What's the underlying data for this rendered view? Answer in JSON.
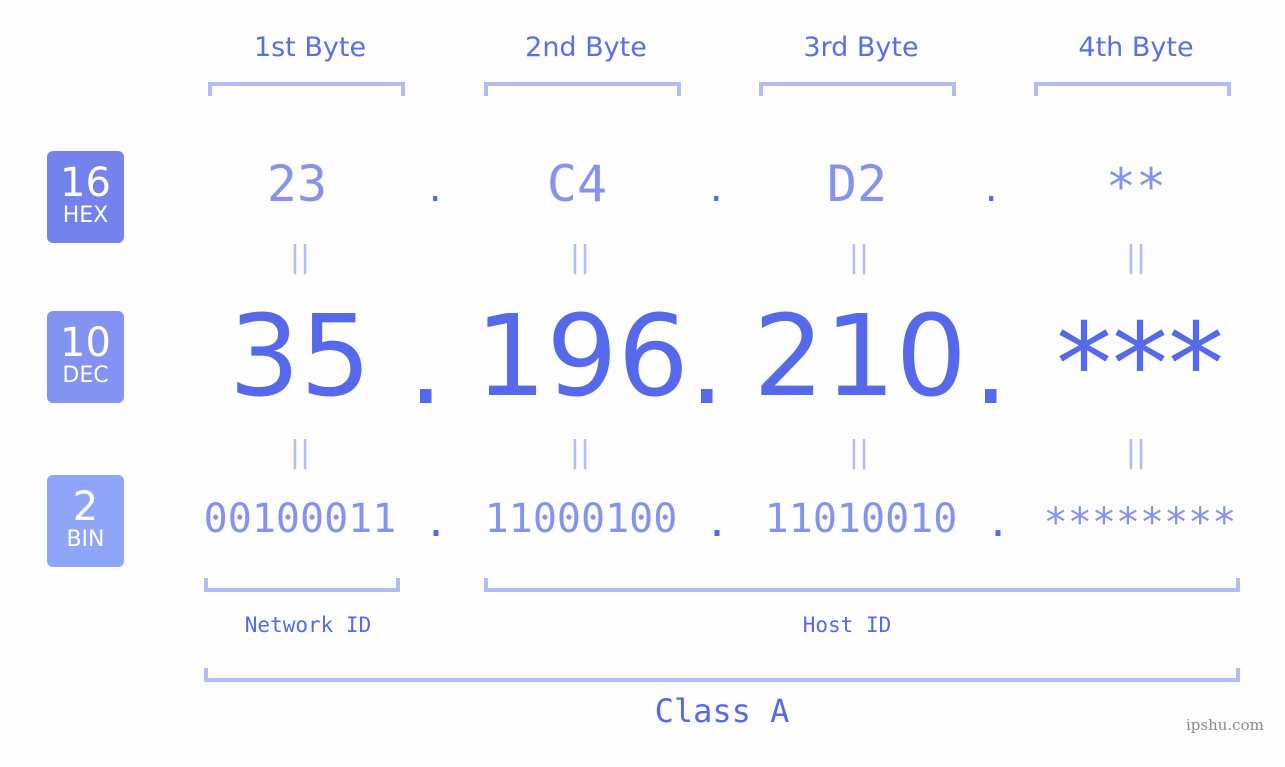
{
  "bytes": {
    "headers": [
      "1st Byte",
      "2nd Byte",
      "3rd Byte",
      "4th Byte"
    ]
  },
  "badges": {
    "hex": {
      "number": "16",
      "label": "HEX",
      "color": "#7582ec"
    },
    "dec": {
      "number": "10",
      "label": "DEC",
      "color": "#8493f2"
    },
    "bin": {
      "number": "2",
      "label": "BIN",
      "color": "#8fa6f8"
    }
  },
  "values": {
    "hex": [
      "23",
      "C4",
      "D2",
      "**"
    ],
    "dec": [
      "35",
      "196",
      "210",
      "***"
    ],
    "bin": [
      "00100011",
      "11000100",
      "11010010",
      "********"
    ],
    "separator": ".",
    "equals": "||"
  },
  "labels": {
    "network_id": "Network ID",
    "host_id": "Host ID",
    "class": "Class A"
  },
  "watermark": "ipshu.com",
  "colors": {
    "accent": "#5569ea",
    "light": "#8792ee",
    "bracket": "#b3bcf7"
  }
}
